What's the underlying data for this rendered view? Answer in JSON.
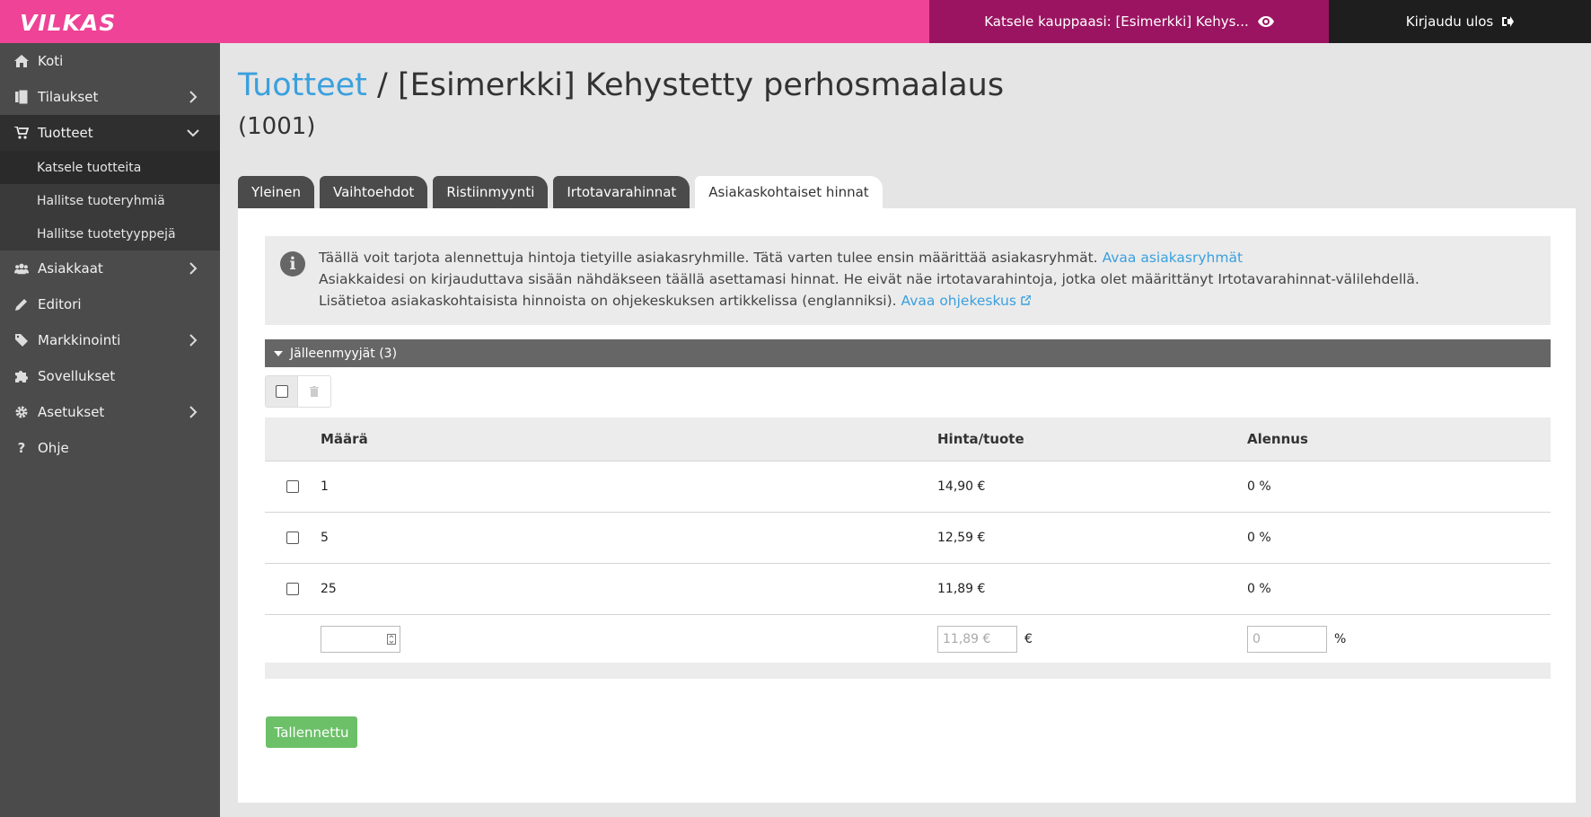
{
  "header": {
    "logo": "VILKAS",
    "view_shop": "Katsele kauppaasi: [Esimerkki] Kehys...",
    "logout": "Kirjaudu ulos"
  },
  "sidebar": {
    "items": [
      {
        "label": "Koti",
        "icon": "home-icon"
      },
      {
        "label": "Tilaukset",
        "icon": "orders-icon"
      },
      {
        "label": "Tuotteet",
        "icon": "cart-icon"
      },
      {
        "label": "Asiakkaat",
        "icon": "users-icon"
      },
      {
        "label": "Editori",
        "icon": "pencil-icon"
      },
      {
        "label": "Markkinointi",
        "icon": "tag-icon"
      },
      {
        "label": "Sovellukset",
        "icon": "puzzle-icon"
      },
      {
        "label": "Asetukset",
        "icon": "gear-icon"
      },
      {
        "label": "Ohje",
        "icon": "question-icon"
      }
    ],
    "subitems": [
      "Katsele tuotteita",
      "Hallitse tuoteryhmiä",
      "Hallitse tuotetyyppejä"
    ]
  },
  "page": {
    "breadcrumb_link": "Tuotteet",
    "separator": " / ",
    "title": "[Esimerkki] Kehystetty perhosmaalaus",
    "product_code": "(1001)"
  },
  "tabs": [
    "Yleinen",
    "Vaihtoehdot",
    "Ristiinmyynti",
    "Irtotavarahinnat",
    "Asiakaskohtaiset hinnat"
  ],
  "info": {
    "line1": "Täällä voit tarjota alennettuja hintoja tietyille asiakasryhmille. Tätä varten tulee ensin määrittää asiakasryhmät.",
    "line1_link": "Avaa asiakasryhmät",
    "line2": "Asiakkaidesi on kirjauduttava sisään nähdäkseen täällä asettamasi hinnat. He eivät näe irtotavarahintoja, jotka olet määrittänyt Irtotavarahinnat-välilehdellä.",
    "line3": "Lisätietoa asiakaskohtaisista hinnoista on ohjekeskuksen artikkelissa (englanniksi).",
    "line3_link": "Avaa ohjekeskus"
  },
  "group": {
    "label": "Jälleenmyyjät (3)"
  },
  "table": {
    "headers": {
      "qty": "Määrä",
      "price": "Hinta/tuote",
      "discount": "Alennus"
    },
    "rows": [
      {
        "qty": "1",
        "price": "14,90 €",
        "discount": "0 %"
      },
      {
        "qty": "5",
        "price": "12,59 €",
        "discount": "0 %"
      },
      {
        "qty": "25",
        "price": "11,89 €",
        "discount": "0 %"
      }
    ],
    "new_row": {
      "qty_value": "",
      "price_placeholder": "11,89 €",
      "price_unit": "€",
      "discount_placeholder": "0",
      "discount_unit": "%"
    }
  },
  "save_button": "Tallennettu",
  "colors": {
    "brand_pink": "#ee4396",
    "dark_pink": "#9b1461",
    "link": "#3aa0de",
    "save_green": "#6cc068"
  }
}
